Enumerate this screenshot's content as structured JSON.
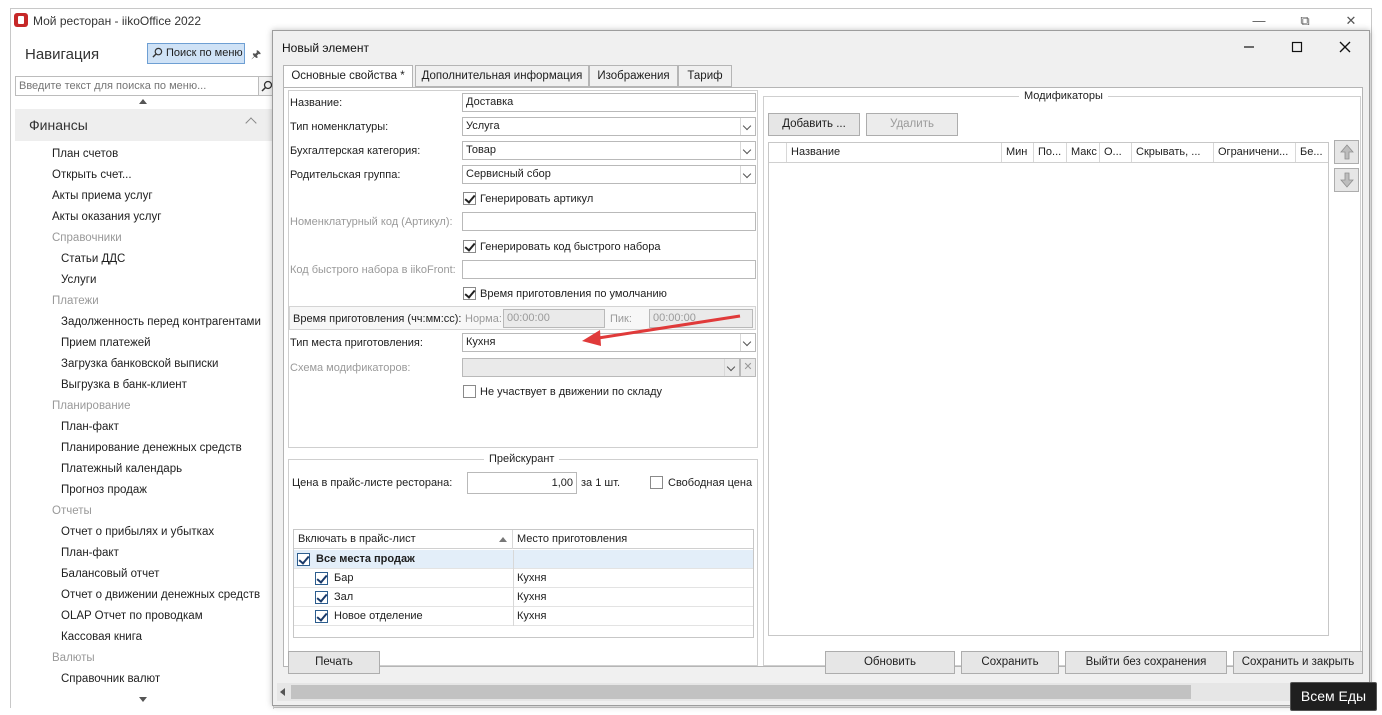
{
  "app": {
    "title": "Мой ресторан - iikoOffice 2022"
  },
  "nav": {
    "title": "Навигация",
    "menu_search_button": "Поиск по меню",
    "search_placeholder": "Введите текст для поиска по меню...",
    "section": "Финансы",
    "items": [
      {
        "label": "План счетов",
        "type": "item"
      },
      {
        "label": "Открыть счет...",
        "type": "item"
      },
      {
        "label": "Акты приема услуг",
        "type": "item"
      },
      {
        "label": "Акты оказания услуг",
        "type": "item"
      },
      {
        "label": "Справочники",
        "type": "category"
      },
      {
        "label": "Статьи ДДС",
        "type": "sub"
      },
      {
        "label": "Услуги",
        "type": "sub"
      },
      {
        "label": "Платежи",
        "type": "category"
      },
      {
        "label": "Задолженность перед контрагентами",
        "type": "sub"
      },
      {
        "label": "Прием платежей",
        "type": "sub"
      },
      {
        "label": "Загрузка банковской выписки",
        "type": "sub"
      },
      {
        "label": "Выгрузка в банк-клиент",
        "type": "sub"
      },
      {
        "label": "Планирование",
        "type": "category"
      },
      {
        "label": "План-факт",
        "type": "sub"
      },
      {
        "label": "Планирование денежных средств",
        "type": "sub"
      },
      {
        "label": "Платежный календарь",
        "type": "sub"
      },
      {
        "label": "Прогноз продаж",
        "type": "sub"
      },
      {
        "label": "Отчеты",
        "type": "category"
      },
      {
        "label": "Отчет о прибылях и убытках",
        "type": "sub"
      },
      {
        "label": "План-факт",
        "type": "sub"
      },
      {
        "label": "Балансовый отчет",
        "type": "sub"
      },
      {
        "label": "Отчет о движении денежных средств",
        "type": "sub"
      },
      {
        "label": "OLAP Отчет по проводкам",
        "type": "sub"
      },
      {
        "label": "Кассовая книга",
        "type": "sub"
      },
      {
        "label": "Валюты",
        "type": "category"
      },
      {
        "label": "Справочник валют",
        "type": "sub"
      }
    ]
  },
  "dialog": {
    "title": "Новый элемент",
    "tabs": [
      {
        "label": "Основные свойства *",
        "active": true
      },
      {
        "label": "Дополнительная информация",
        "active": false
      },
      {
        "label": "Изображения",
        "active": false
      },
      {
        "label": "Тариф",
        "active": false
      }
    ],
    "form": {
      "name_label": "Название:",
      "name_value": "Доставка",
      "nomenclature_type_label": "Тип номенклатуры:",
      "nomenclature_type_value": "Услуга",
      "accounting_category_label": "Бухгалтерская категория:",
      "accounting_category_value": "Товар",
      "parent_group_label": "Родительская группа:",
      "parent_group_value": "Сервисный сбор",
      "generate_article_label": "Генерировать артикул",
      "generate_article_checked": true,
      "article_code_label": "Номенклатурный код (Артикул):",
      "article_code_value": "",
      "generate_quick_code_label": "Генерировать код быстрого набора",
      "generate_quick_code_checked": true,
      "quick_code_label": "Код быстрого набора в iikoFront:",
      "quick_code_value": "",
      "default_cooking_time_label": "Время приготовления по умолчанию",
      "default_cooking_time_checked": true,
      "cooking_time_label": "Время приготовления (чч:мм:сс):",
      "norm_label": "Норма:",
      "norm_value": "00:00:00",
      "peak_label": "Пик:",
      "peak_value": "00:00:00",
      "cooking_place_type_label": "Тип места приготовления:",
      "cooking_place_type_value": "Кухня",
      "modifier_scheme_label": "Схема модификаторов:",
      "modifier_scheme_value": "",
      "no_stock_movement_label": "Не участвует в движении по складу",
      "no_stock_movement_checked": false
    },
    "price": {
      "group_title": "Прейскурант",
      "price_label": "Цена в прайс-листе ресторана:",
      "price_value": "1,00",
      "per_unit": "за 1 шт.",
      "free_price_label": "Свободная цена",
      "free_price_checked": false,
      "columns": [
        "Включать в прайс-лист",
        "Место приготовления"
      ],
      "group_row": {
        "label": "Все места продаж",
        "checked": true
      },
      "rows": [
        {
          "name": "Бар",
          "place": "Кухня",
          "checked": true
        },
        {
          "name": "Зал",
          "place": "Кухня",
          "checked": true
        },
        {
          "name": "Новое отделение",
          "place": "Кухня",
          "checked": true
        }
      ]
    },
    "modifiers": {
      "group_title": "Модификаторы",
      "add_button": "Добавить ...",
      "delete_button": "Удалить",
      "columns": [
        "Название",
        "Мин",
        "По...",
        "Макс",
        "О...",
        "Скрывать, ...",
        "Ограничени...",
        "Бе..."
      ]
    },
    "footer": {
      "print": "Печать",
      "refresh": "Обновить",
      "save": "Сохранить",
      "exit_no_save": "Выйти без сохранения",
      "save_close": "Сохранить и закрыть"
    }
  },
  "tooltip": "Всем Еды",
  "colors": {
    "annotation_arrow": "#e03a3a",
    "selected_button": "#cfe2f6"
  }
}
